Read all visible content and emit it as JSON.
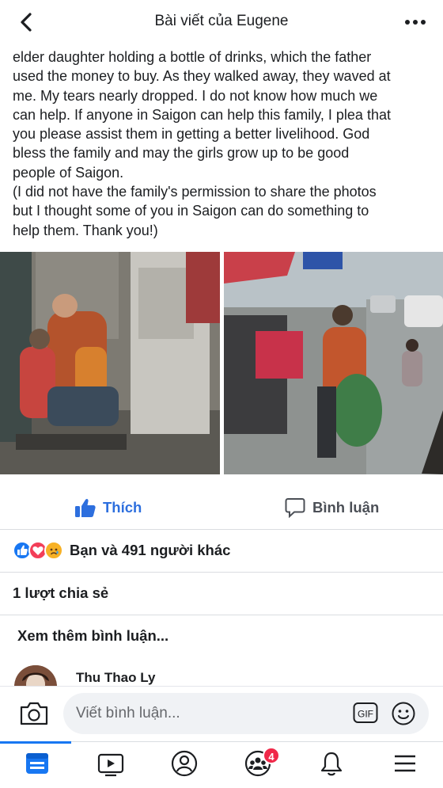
{
  "header": {
    "title": "Bài viết của Eugene",
    "back_icon": "chevron-left-icon",
    "more_icon": "more-dots-icon"
  },
  "post": {
    "lines": [
      "elder daughter holding a bottle of drinks, which the father",
      "used the money to buy. As they walked away, they waved at",
      "me. My tears nearly dropped. I do not know how much we",
      "can help. If anyone in Saigon can help this family, I plea that",
      "you please assist them in getting a better livelihood. God",
      "bless the family and may the girls grow up to be good",
      "people of Saigon.",
      "(I did not have the family's permission to share the photos",
      "but I thought some of you in Saigon can do something to",
      "help them. Thank you!)"
    ]
  },
  "photos": [
    {
      "name": "photo-family-sitting"
    },
    {
      "name": "photo-family-walking"
    }
  ],
  "actions": {
    "like_label": "Thích",
    "comment_label": "Bình luận"
  },
  "reactions": {
    "text": "Bạn và 491 người khác",
    "icons": [
      "like-reaction-icon",
      "love-reaction-icon",
      "sad-reaction-icon"
    ]
  },
  "shares": {
    "text": "1 lượt chia sẻ"
  },
  "comments": {
    "more_label": "Xem thêm bình luận...",
    "items": [
      {
        "author": "Thu Thao Ly"
      }
    ]
  },
  "composer": {
    "placeholder": "Viết bình luận...",
    "gif_label": "GIF"
  },
  "tabbar": {
    "active_index": 0,
    "tabs": [
      "news-feed-icon",
      "watch-icon",
      "profile-icon",
      "groups-icon",
      "notifications-icon",
      "menu-icon"
    ],
    "groups_badge": "4"
  },
  "colors": {
    "accent": "#1877f2",
    "like_blue": "#2d6fde",
    "badge_red": "#f02849"
  }
}
